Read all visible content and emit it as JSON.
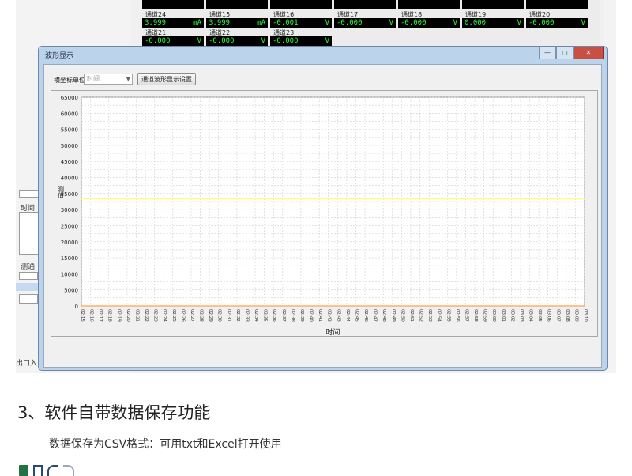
{
  "channels": [
    {
      "name": "",
      "value": "",
      "unit": ""
    },
    {
      "name": "",
      "value": "",
      "unit": ""
    },
    {
      "name": "",
      "value": "",
      "unit": ""
    },
    {
      "name": "",
      "value": "",
      "unit": ""
    },
    {
      "name": "",
      "value": "",
      "unit": ""
    },
    {
      "name": "",
      "value": "",
      "unit": ""
    },
    {
      "name": "",
      "value": "",
      "unit": ""
    },
    {
      "name": "通道24",
      "value": "3.999",
      "unit": "mA"
    },
    {
      "name": "通道15",
      "value": "3.999",
      "unit": "mA"
    },
    {
      "name": "通道16",
      "value": "-0.001",
      "unit": "V"
    },
    {
      "name": "通道17",
      "value": "-0.000",
      "unit": "V"
    },
    {
      "name": "通道18",
      "value": "-0.000",
      "unit": "V"
    },
    {
      "name": "通道19",
      "value": "0.000",
      "unit": "V"
    },
    {
      "name": "通道20",
      "value": "-0.000",
      "unit": "V"
    },
    {
      "name": "通道21",
      "value": "-0.000",
      "unit": "V"
    },
    {
      "name": "通道22",
      "value": "-0.000",
      "unit": "V"
    },
    {
      "name": "通道23",
      "value": "-0.000",
      "unit": "V"
    }
  ],
  "background": {
    "label_time": "时间",
    "label_channel": "测通",
    "status_text": "出口入"
  },
  "dialog": {
    "title": "波形显示",
    "window_buttons": {
      "minimize": "—",
      "maximize": "□",
      "close": "✕"
    },
    "toolbar": {
      "unit_label": "横坐标单位",
      "unit_select_value": "时间",
      "settings_button": "通道波形显示设置"
    }
  },
  "colors": {
    "dialog_frame": "#bcd3ec",
    "plot_background": "#ffffff",
    "series_yellow": "#ffff70",
    "series_orange": "#ffb060",
    "channel_text": "#2bff3c"
  },
  "chart_data": {
    "type": "line",
    "xlabel": "时间",
    "ylabel": "测值",
    "ylim": [
      0,
      65000
    ],
    "yticks": [
      0,
      5000,
      10000,
      15000,
      20000,
      25000,
      30000,
      35000,
      40000,
      45000,
      50000,
      55000,
      60000,
      65000
    ],
    "grid": true,
    "xticks": [
      "02:15",
      "02:16",
      "02:17",
      "02:18",
      "02:19",
      "02:20",
      "02:21",
      "02:22",
      "02:23",
      "02:24",
      "02:25",
      "02:26",
      "02:27",
      "02:28",
      "02:29",
      "02:30",
      "02:31",
      "02:32",
      "02:33",
      "02:34",
      "02:35",
      "02:36",
      "02:37",
      "02:38",
      "02:39",
      "02:40",
      "02:41",
      "02:42",
      "02:43",
      "02:44",
      "02:45",
      "02:46",
      "02:47",
      "02:48",
      "02:49",
      "02:50",
      "02:51",
      "02:52",
      "02:53",
      "02:54",
      "02:55",
      "02:56",
      "02:57",
      "02:58",
      "02:59",
      "03:00",
      "03:01",
      "03:02",
      "03:03",
      "03:04",
      "03:05",
      "03:06",
      "03:07",
      "03:08",
      "03:09",
      "03:10"
    ],
    "series": [
      {
        "color": "#ffff70",
        "values": [
          33400,
          33400
        ]
      },
      {
        "color": "#ffb060",
        "values": [
          0,
          0
        ]
      }
    ]
  },
  "article": {
    "heading": "3、软件自带数据保存功能",
    "paragraph": "数据保存为CSV格式：可用txt和Excel打开使用"
  },
  "toolbar_icons": [
    "excel-icon",
    "save-icon",
    "undo-icon",
    "redo-icon"
  ]
}
